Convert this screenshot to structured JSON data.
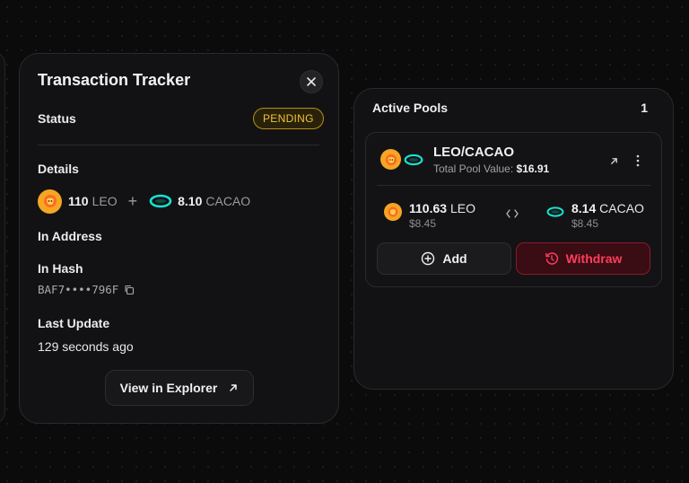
{
  "tracker": {
    "title": "Transaction Tracker",
    "status_label": "Status",
    "status_value": "PENDING",
    "details_label": "Details",
    "leo_amount": "110",
    "leo_symbol": "LEO",
    "plus": "+",
    "cacao_amount": "8.10",
    "cacao_symbol": "CACAO",
    "in_address_label": "In Address",
    "in_hash_label": "In Hash",
    "in_hash_value": "BAF7••••796F",
    "last_update_label": "Last Update",
    "last_update_value": "129 seconds ago",
    "explorer_button": "View in Explorer"
  },
  "pools": {
    "title": "Active Pools",
    "count": "1",
    "items": [
      {
        "name": "LEO/CACAO",
        "total_label": "Total Pool Value:",
        "total_value": "$16.91",
        "asset1_amount": "110.63",
        "asset1_symbol": "LEO",
        "asset1_usd": "$8.45",
        "asset2_amount": "8.14",
        "asset2_symbol": "CACAO",
        "asset2_usd": "$8.45",
        "add_label": "Add",
        "withdraw_label": "Withdraw"
      }
    ]
  },
  "colors": {
    "pending": "#f0c23a",
    "withdraw": "#ff3d5c",
    "leo": "#f5a623",
    "cacao": "#19e3d0"
  },
  "icons": [
    "close-icon",
    "leo-coin-icon",
    "cacao-coin-icon",
    "copy-icon",
    "arrow-up-right-icon",
    "more-vertical-icon",
    "swap-arrows-icon",
    "plus-circle-icon",
    "withdraw-icon"
  ]
}
